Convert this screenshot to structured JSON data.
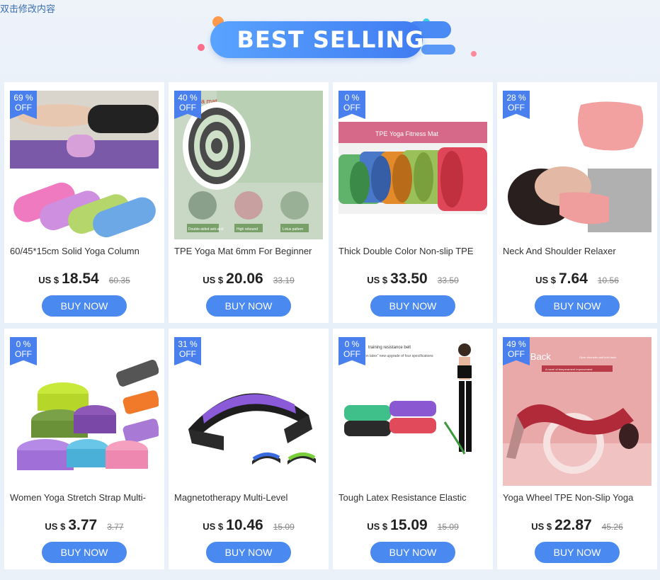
{
  "edit_hint": "双击修改内容",
  "banner": {
    "title": "BEST SELLING"
  },
  "colors": {
    "accent": "#4a89ef",
    "badge": "#4a80ee"
  },
  "products": [
    {
      "discount": "69 %",
      "off": "OFF",
      "name": "60/45*15cm Solid Yoga Column",
      "currency": "US $",
      "price": "18.54",
      "old_price": "60.35",
      "button": "BUY NOW",
      "image": "foam-roller-image"
    },
    {
      "discount": "40 %",
      "off": "OFF",
      "name": "TPE Yoga Mat 6mm For Beginner",
      "currency": "US $",
      "price": "20.06",
      "old_price": "33.19",
      "button": "BUY NOW",
      "image": "yoga-mat-image",
      "image_text": {
        "top": "oga mat",
        "cap1": "Double-sided anti-skid",
        "cap2": "High rebound",
        "cap3": "Lotus pattern"
      }
    },
    {
      "discount": "0 %",
      "off": "OFF",
      "name": "Thick Double Color Non-slip TPE",
      "currency": "US $",
      "price": "33.50",
      "old_price": "33.50",
      "button": "BUY NOW",
      "image": "rolled-mats-image",
      "image_text": {
        "header": "TPE Yoga Fitness Mat"
      }
    },
    {
      "discount": "28 %",
      "off": "OFF",
      "name": "Neck And Shoulder Relaxer",
      "currency": "US $",
      "price": "7.64",
      "old_price": "10.56",
      "button": "BUY NOW",
      "image": "neck-relaxer-image"
    },
    {
      "discount": "0 %",
      "off": "OFF",
      "name": "Women Yoga Stretch Strap Multi-",
      "currency": "US $",
      "price": "3.77",
      "old_price": "3.77",
      "button": "BUY NOW",
      "image": "yoga-straps-image"
    },
    {
      "discount": "31 %",
      "off": "OFF",
      "name": "Magnetotherapy Multi-Level",
      "currency": "US $",
      "price": "10.46",
      "old_price": "15.09",
      "button": "BUY NOW",
      "image": "back-stretcher-image"
    },
    {
      "discount": "0 %",
      "off": "OFF",
      "name": "Tough Latex Resistance  Elastic",
      "currency": "US $",
      "price": "15.09",
      "old_price": "15.09",
      "button": "BUY NOW",
      "image": "resistance-bands-image",
      "image_text": {
        "line1": "training resistance belt",
        "line2": "ion latex\" new upgrade of four specifications"
      }
    },
    {
      "discount": "49 %",
      "off": "OFF",
      "name": "Yoga Wheel TPE Non-Slip Yoga",
      "currency": "US $",
      "price": "22.87",
      "old_price": "45.26",
      "button": "BUY NOW",
      "image": "yoga-wheel-image",
      "image_text": {
        "title": "d Back",
        "sub1": "Open shoulder and hold back",
        "sub2": "A novel of temperament improvement"
      }
    }
  ]
}
